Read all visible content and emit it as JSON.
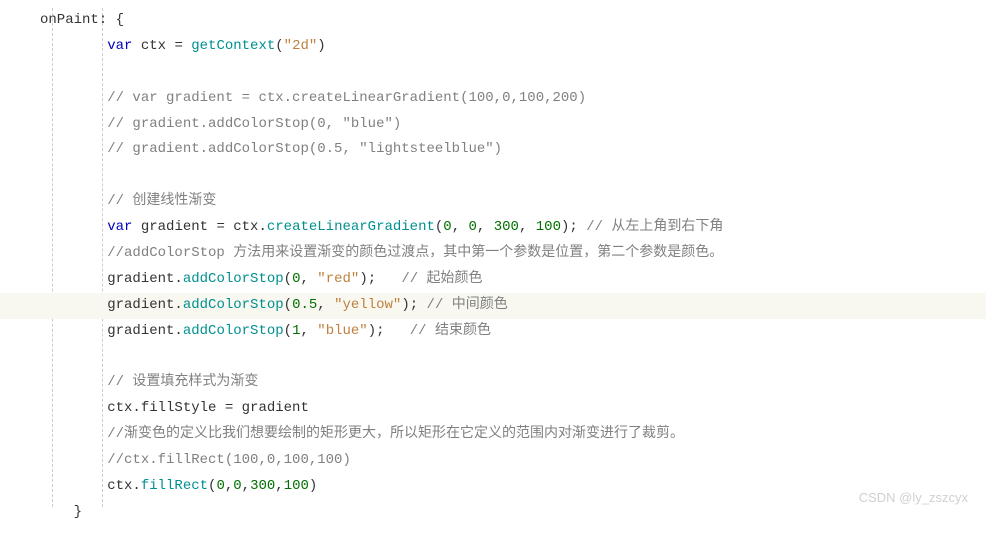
{
  "code": {
    "l1_kw": "onPaint:",
    "l1_brace": " {",
    "l2_var": "var",
    "l2_ctx": " ctx = ",
    "l2_fn": "getContext",
    "l2_paren": "(",
    "l2_str": "\"2d\"",
    "l2_close": ")",
    "l4_comment": "// var gradient = ctx.createLinearGradient(100,0,100,200)",
    "l5_comment": "// gradient.addColorStop(0, \"blue\")",
    "l6_comment": "// gradient.addColorStop(0.5, \"lightsteelblue\")",
    "l8_comment": "// 创建线性渐变",
    "l9_var": "var",
    "l9_text1": " gradient = ctx.",
    "l9_fn": "createLinearGradient",
    "l9_p1": "(",
    "l9_n1": "0",
    "l9_c1": ", ",
    "l9_n2": "0",
    "l9_c2": ", ",
    "l9_n3": "300",
    "l9_c3": ", ",
    "l9_n4": "100",
    "l9_close": "); ",
    "l9_comment": "// 从左上角到右下角",
    "l10_comment": "//addColorStop 方法用来设置渐变的颜色过渡点，其中第一个参数是位置，第二个参数是颜色。",
    "l11_obj": "gradient.",
    "l11_fn": "addColorStop",
    "l11_p1": "(",
    "l11_n": "0",
    "l11_c": ", ",
    "l11_str": "\"red\"",
    "l11_close": ");   ",
    "l11_comment": "// 起始颜色",
    "l12_obj": "gradient.",
    "l12_fn": "addColorStop",
    "l12_p1": "(",
    "l12_n": "0.5",
    "l12_c": ", ",
    "l12_str": "\"yellow\"",
    "l12_close": "); ",
    "l12_comment": "// 中间颜色",
    "l13_obj": "gradient.",
    "l13_fn": "addColorStop",
    "l13_p1": "(",
    "l13_n": "1",
    "l13_c": ", ",
    "l13_str": "\"blue\"",
    "l13_close": ");   ",
    "l13_comment": "// 结束颜色",
    "l15_comment": "// 设置填充样式为渐变",
    "l16_text": "ctx.fillStyle = gradient",
    "l17_comment": "//渐变色的定义比我们想要绘制的矩形更大，所以矩形在它定义的范围内对渐变进行了裁剪。",
    "l18_comment": "//ctx.fillRect(100,0,100,100)",
    "l19_obj": "ctx.",
    "l19_fn": "fillRect",
    "l19_p1": "(",
    "l19_n1": "0",
    "l19_c1": ",",
    "l19_n2": "0",
    "l19_c2": ",",
    "l19_n3": "300",
    "l19_c3": ",",
    "l19_n4": "100",
    "l19_close": ")",
    "l20_brace": "}"
  },
  "watermark": "CSDN @ly_zszcyx"
}
